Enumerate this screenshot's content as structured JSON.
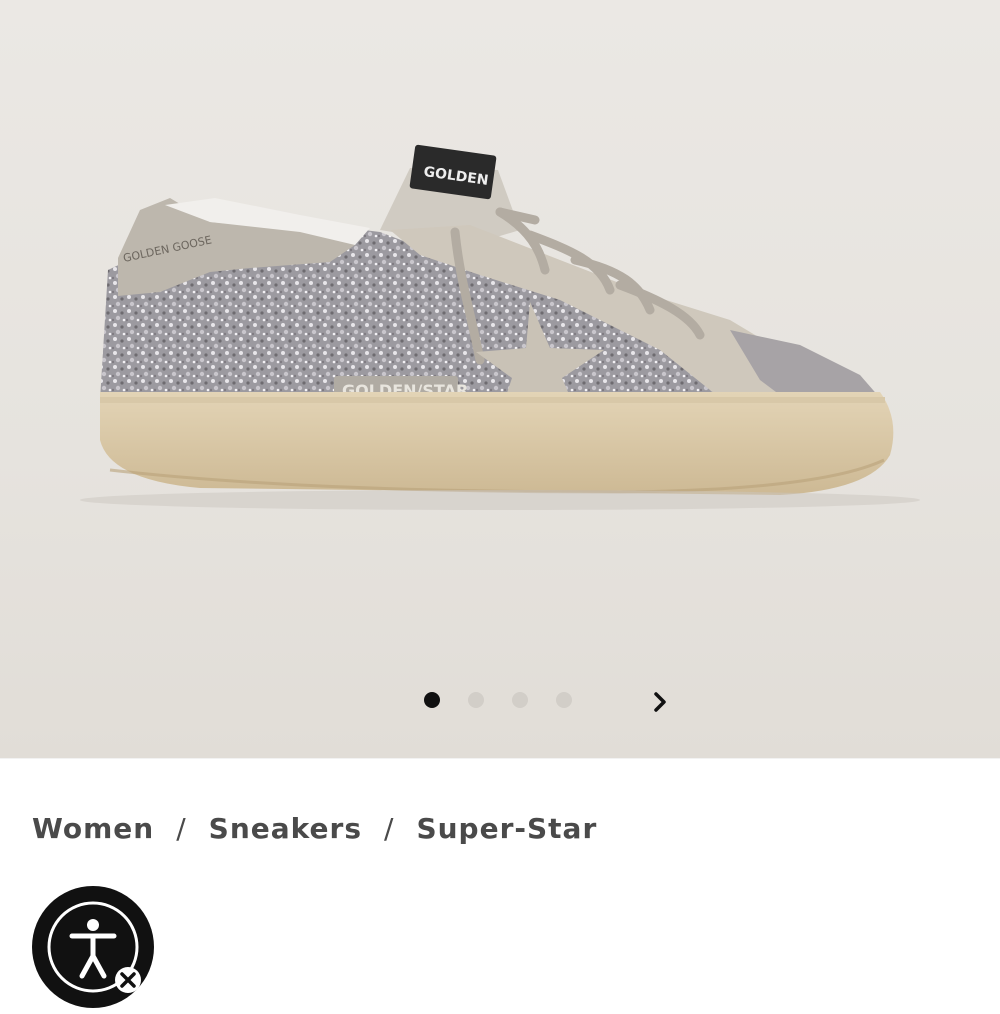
{
  "gallery": {
    "image_alt": "Super-Star sneaker, silver glitter upper with suede star",
    "brand_tab_text": "GOLDEN",
    "side_logo_text": "GOLDEN/STAR",
    "heel_text": "GOLDEN GOOSE",
    "slide_count": 4,
    "active_slide": 1
  },
  "breadcrumb": {
    "items": [
      "Women",
      "Sneakers",
      "Super-Star"
    ],
    "separator": "/"
  },
  "accessibility": {
    "label": "Accessibility"
  },
  "colors": {
    "background": "#e8e5e1",
    "active_dot": "#111111",
    "inactive_dot": "#d2cec8",
    "breadcrumb_text": "#4a4a4a"
  }
}
